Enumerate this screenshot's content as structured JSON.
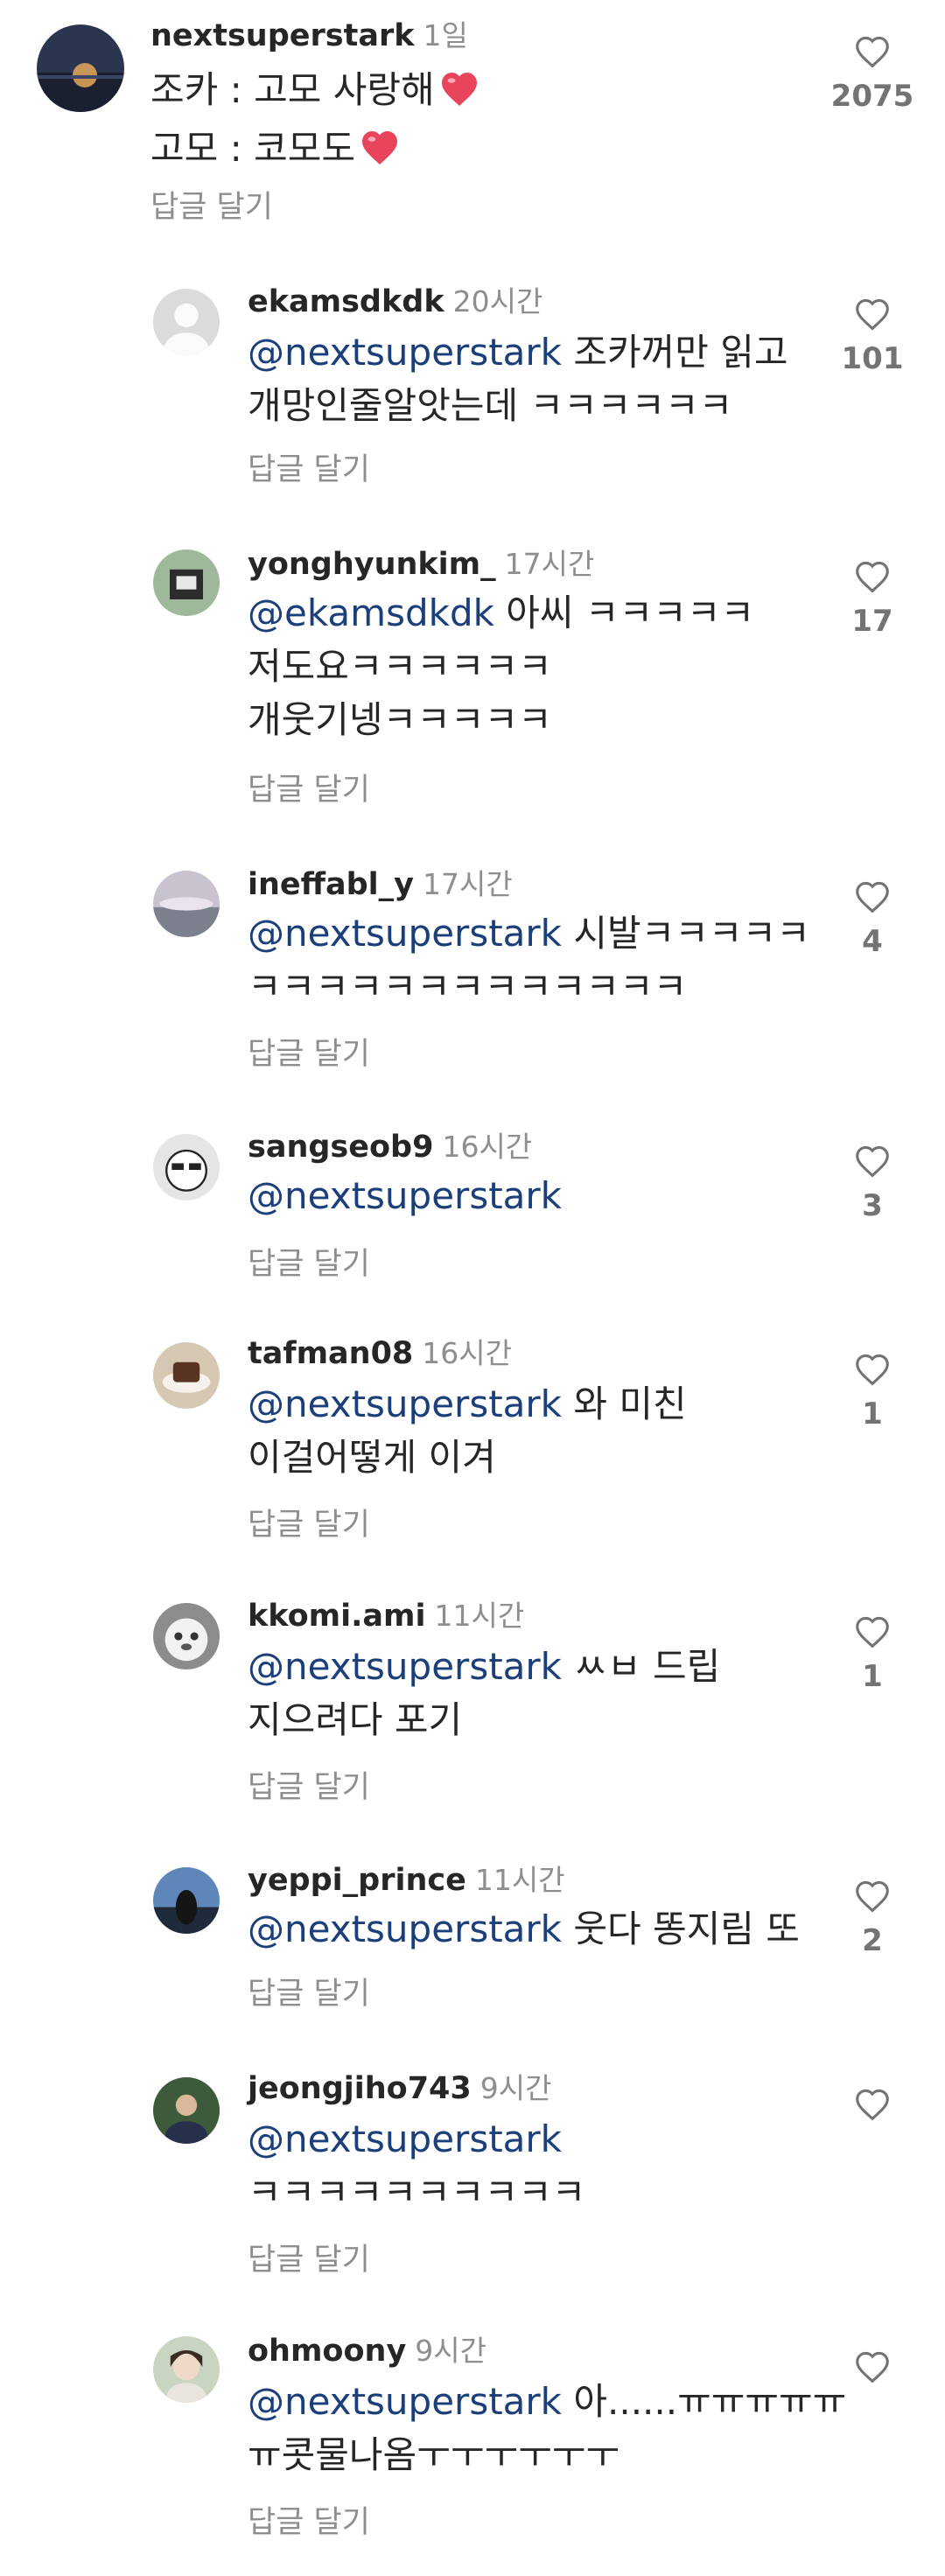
{
  "comments": [
    {
      "user": "nextsuperstark",
      "time": "1일",
      "lines": [
        {
          "text": "조카 : 고모 사랑해",
          "heart": true
        },
        {
          "text": "고모 : 코모도",
          "heart": true
        }
      ],
      "reply": "답글 달기",
      "likes": "2075"
    },
    {
      "user": "ekamsdkdk",
      "time": "20시간",
      "lines": [
        {
          "mention": "@nextsuperstark",
          "text": " 조카꺼만 읽고"
        },
        {
          "text": "개망인줄알앗는데 ㅋㅋㅋㅋㅋㅋ"
        }
      ],
      "reply": "답글 달기",
      "likes": "101"
    },
    {
      "user": "yonghyunkim_",
      "time": "17시간",
      "lines": [
        {
          "mention": "@ekamsdkdk",
          "text": " 아씨 ㅋㅋㅋㅋㅋ"
        },
        {
          "text": "저도요ㅋㅋㅋㅋㅋㅋ"
        },
        {
          "text": "개웃기넹ㅋㅋㅋㅋㅋ"
        }
      ],
      "reply": "답글 달기",
      "likes": "17"
    },
    {
      "user": "ineffabl_y",
      "time": "17시간",
      "lines": [
        {
          "mention": "@nextsuperstark",
          "text": " 시발ㅋㅋㅋㅋㅋ"
        },
        {
          "text": "ㅋㅋㅋㅋㅋㅋㅋㅋㅋㅋㅋㅋㅋ"
        }
      ],
      "reply": "답글 달기",
      "likes": "4"
    },
    {
      "user": "sangseob9",
      "time": "16시간",
      "lines": [
        {
          "mention": "@nextsuperstark",
          "text": ""
        }
      ],
      "reply": "답글 달기",
      "likes": "3"
    },
    {
      "user": "tafman08",
      "time": "16시간",
      "lines": [
        {
          "mention": "@nextsuperstark",
          "text": " 와 미친"
        },
        {
          "text": "이걸어떻게 이겨"
        }
      ],
      "reply": "답글 달기",
      "likes": "1"
    },
    {
      "user": "kkomi.ami",
      "time": "11시간",
      "lines": [
        {
          "mention": "@nextsuperstark",
          "text": " ㅆㅂ 드립"
        },
        {
          "text": "지으려다 포기"
        }
      ],
      "reply": "답글 달기",
      "likes": "1"
    },
    {
      "user": "yeppi_prince",
      "time": "11시간",
      "lines": [
        {
          "mention": "@nextsuperstark",
          "text": " 웃다 똥지림 또"
        }
      ],
      "reply": "답글 달기",
      "likes": "2"
    },
    {
      "user": "jeongjiho743",
      "time": "9시간",
      "lines": [
        {
          "mention": "@nextsuperstark",
          "text": ""
        },
        {
          "text": "ㅋㅋㅋㅋㅋㅋㅋㅋㅋㅋ"
        }
      ],
      "reply": "답글 달기",
      "likes": ""
    },
    {
      "user": "ohmoony",
      "time": "9시간",
      "lines": [
        {
          "mention": "@nextsuperstark",
          "text": " 아......ㅠㅠㅠㅠㅠ"
        },
        {
          "text": "ㅠ콧물나옴ㅜㅜㅜㅜㅜㅜ"
        }
      ],
      "reply": "답글 달기",
      "likes": ""
    }
  ],
  "colors": {
    "mention": "#1a3f7a",
    "muted": "#8e8e8e",
    "heart": "#e8455d"
  }
}
